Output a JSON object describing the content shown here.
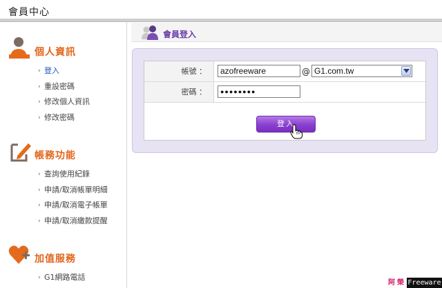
{
  "header": {
    "title": "會員中心"
  },
  "sidebar": {
    "sections": [
      {
        "title": "個人資訊",
        "icon": "person-icon",
        "items": [
          {
            "label": "登入",
            "active": true
          },
          {
            "label": "重設密碼"
          },
          {
            "label": "修改個人資訊"
          },
          {
            "label": "修改密碼"
          }
        ]
      },
      {
        "title": "帳務功能",
        "icon": "edit-document-icon",
        "items": [
          {
            "label": "查詢使用紀錄"
          },
          {
            "label": "申請/取消帳單明細"
          },
          {
            "label": "申請/取消電子帳單"
          },
          {
            "label": "申請/取消繳款提醒"
          }
        ]
      },
      {
        "title": "加值服務",
        "icon": "heart-plus-icon",
        "items": [
          {
            "label": "G1網路電話"
          }
        ]
      }
    ]
  },
  "content": {
    "tab_title": "會員登入",
    "form": {
      "account_label": "帳號 ：",
      "account_value": "azofreeware",
      "at_sign": "@",
      "domain_value": "G1.com.tw",
      "password_label": "密碼 ：",
      "password_value": "●●●●●●●●",
      "login_button": "登入"
    }
  },
  "watermark": {
    "left": "阿榮",
    "right": "Freeware"
  },
  "colors": {
    "accent_orange": "#e2651b",
    "accent_purple": "#8a3fd0",
    "panel_lavender": "#e7e3f4",
    "active_link": "#1a55b5"
  }
}
